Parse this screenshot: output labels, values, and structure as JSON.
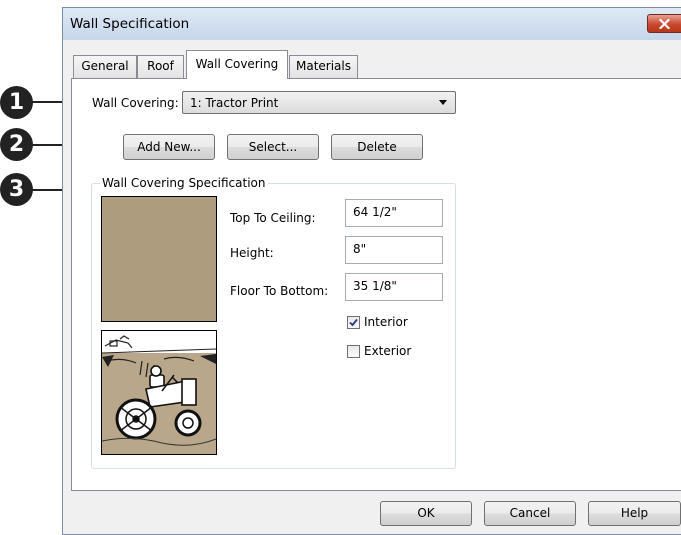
{
  "window": {
    "title": "Wall Specification"
  },
  "tabs": [
    {
      "label": "General",
      "active": false
    },
    {
      "label": "Roof",
      "active": false
    },
    {
      "label": "Wall Covering",
      "active": true
    },
    {
      "label": "Materials",
      "active": false
    }
  ],
  "wall_covering": {
    "label": "Wall Covering:",
    "selected": "1:  Tractor Print"
  },
  "buttons": {
    "add_new": "Add New...",
    "select": "Select...",
    "delete": "Delete"
  },
  "spec": {
    "group_label": "Wall Covering Specification",
    "swatch_color": "#ae9c7e",
    "top_to_ceiling": {
      "label": "Top To Ceiling:",
      "value": "64 1/2\""
    },
    "height": {
      "label": "Height:",
      "value": "8\""
    },
    "floor_to_bottom": {
      "label": "Floor To Bottom:",
      "value": "35 1/8\""
    },
    "interior": {
      "label": "Interior",
      "checked": true
    },
    "exterior": {
      "label": "Exterior",
      "checked": false
    }
  },
  "footer": {
    "ok": "OK",
    "cancel": "Cancel",
    "help": "Help"
  },
  "callouts": [
    "1",
    "2",
    "3"
  ],
  "colors": {
    "close_button": "#c9482e",
    "callout": "#222222"
  }
}
